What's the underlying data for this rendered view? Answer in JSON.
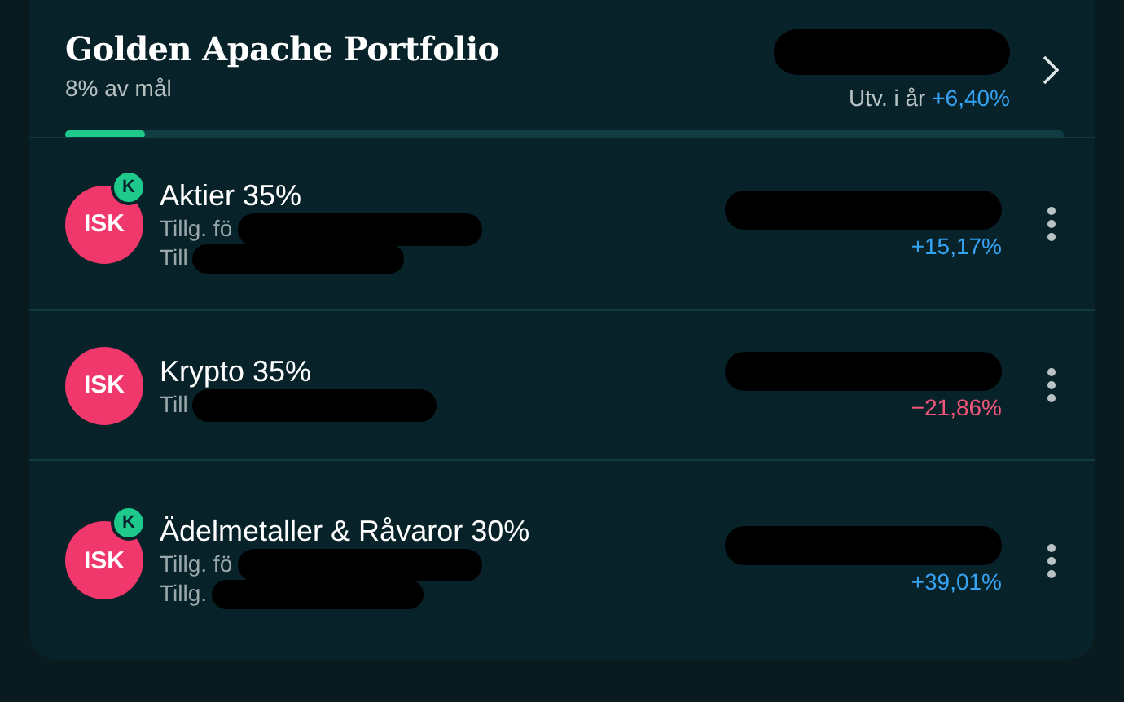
{
  "portfolio": {
    "title": "Golden Apache Portfolio",
    "goal_progress": "8% av mål",
    "level": 0.08,
    "growth_label": "Utv. i år",
    "growth_value": "+6,40%"
  },
  "accounts": [
    {
      "badge": "ISK",
      "tag": "K",
      "name": "Aktier 35%",
      "details": [
        "Tillg. fö",
        "Till"
      ],
      "change": "+15,17%",
      "color": "#35a3f2"
    },
    {
      "badge": "ISK",
      "name": "Krypto 35%",
      "details": [
        "Till"
      ],
      "change": "−21,86%",
      "color": "#f2567a"
    },
    {
      "badge": "ISK",
      "tag": "K",
      "name": "Ädelmetaller & Råvaror 30%",
      "details": [
        "Tillg. fö",
        "Tillg."
      ],
      "change": "+39,01%",
      "color": "#35a3f2"
    }
  ]
}
